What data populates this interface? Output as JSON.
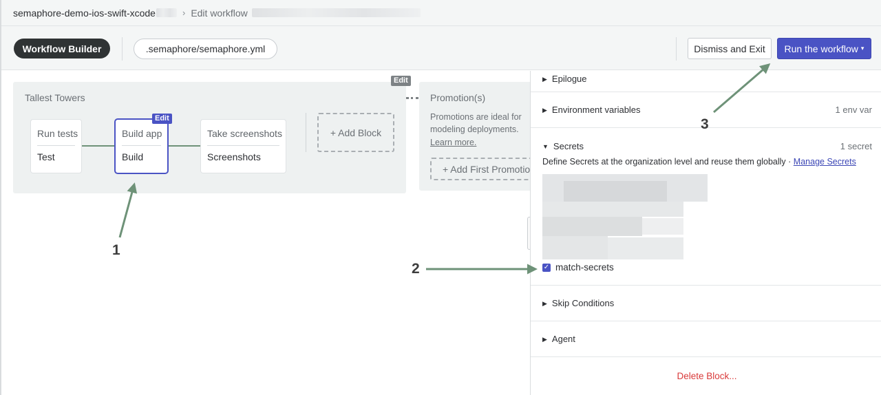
{
  "breadcrumb": {
    "project": "semaphore-demo-ios-swift-xcode",
    "separator": "›",
    "current": "Edit workflow"
  },
  "toolbar": {
    "workflow_builder_label": "Workflow Builder",
    "file_path": ".semaphore/semaphore.yml",
    "dismiss_label": "Dismiss and Exit",
    "run_label": "Run the workflow",
    "run_caret": "▾"
  },
  "pipeline": {
    "name": "Tallest Towers",
    "edit_label": "Edit",
    "blocks": [
      {
        "name": "Run tests",
        "job": "Test"
      },
      {
        "name": "Build app",
        "job": "Build",
        "selected": true,
        "edit_label": "Edit"
      },
      {
        "name": "Take screenshots",
        "job": "Screenshots"
      }
    ],
    "add_block_label": "+ Add Block"
  },
  "promotion": {
    "title": "Promotion(s)",
    "description": "Promotions are ideal for modeling deployments.",
    "learn_more": "Learn more.",
    "add_first_label": "+ Add First Promotion"
  },
  "panel": {
    "epilogue": "Epilogue",
    "env_vars": {
      "label": "Environment variables",
      "count": "1 env var"
    },
    "secrets": {
      "label": "Secrets",
      "count": "1 secret",
      "description": "Define Secrets at the organization level and reuse them globally · ",
      "manage_link": "Manage Secrets",
      "checked_secret": "match-secrets"
    },
    "skip_conditions": "Skip Conditions",
    "agent": "Agent",
    "delete_label": "Delete Block..."
  },
  "annotations": {
    "labels": [
      "1",
      "2",
      "3"
    ],
    "color": "#6e9278"
  },
  "colors": {
    "accent": "#4a53c4",
    "dark_button": "#2f3334",
    "danger": "#d93a3a"
  }
}
